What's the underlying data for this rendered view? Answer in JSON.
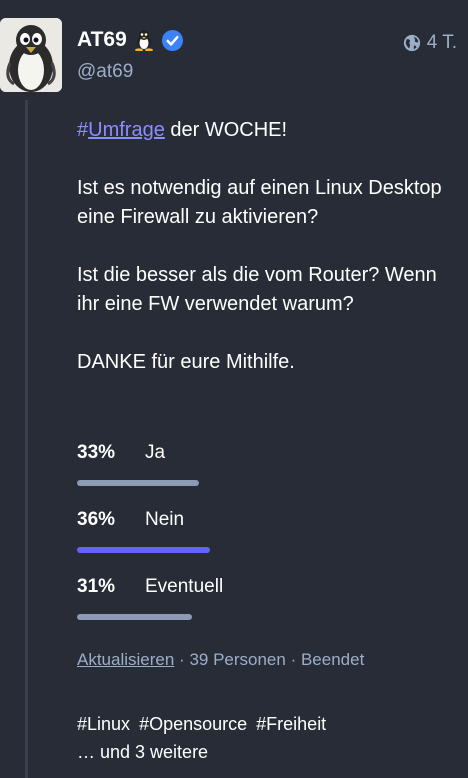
{
  "account": {
    "display_name": "AT69",
    "handle": "@at69",
    "time": "4 T.",
    "avatar": "penguin-avatar",
    "badge_icons": [
      "tux-icon",
      "verified-icon"
    ],
    "visibility_icon": "globe-icon"
  },
  "post": {
    "hashtag_prefix": "#",
    "hashtag": "Umfrage",
    "line1_rest": " der WOCHE!",
    "para2": "Ist es notwendig auf einen Linux Desktop eine Firewall zu aktivieren?",
    "para3": "Ist die besser als die vom Router? Wenn ihr eine FW verwendet warum?",
    "para4": "DANKE für eure Mithilfe."
  },
  "poll": {
    "options": [
      {
        "percent": "33%",
        "label": "Ja",
        "fraction": 0.33,
        "leading": false
      },
      {
        "percent": "36%",
        "label": "Nein",
        "fraction": 0.36,
        "leading": true
      },
      {
        "percent": "31%",
        "label": "Eventuell",
        "fraction": 0.31,
        "leading": false
      }
    ],
    "refresh_label": "Aktualisieren",
    "sep": " · ",
    "voters": "39 Personen",
    "status": "Beendet"
  },
  "tags": {
    "items": [
      "#Linux",
      "#Opensource",
      "#Freiheit"
    ],
    "more": "… und 3 weitere"
  },
  "colors": {
    "background": "#282c37",
    "accent": "#6364ff",
    "bar": "#8d9ab3",
    "muted": "#9baec8",
    "verified": "#3b82f6"
  }
}
